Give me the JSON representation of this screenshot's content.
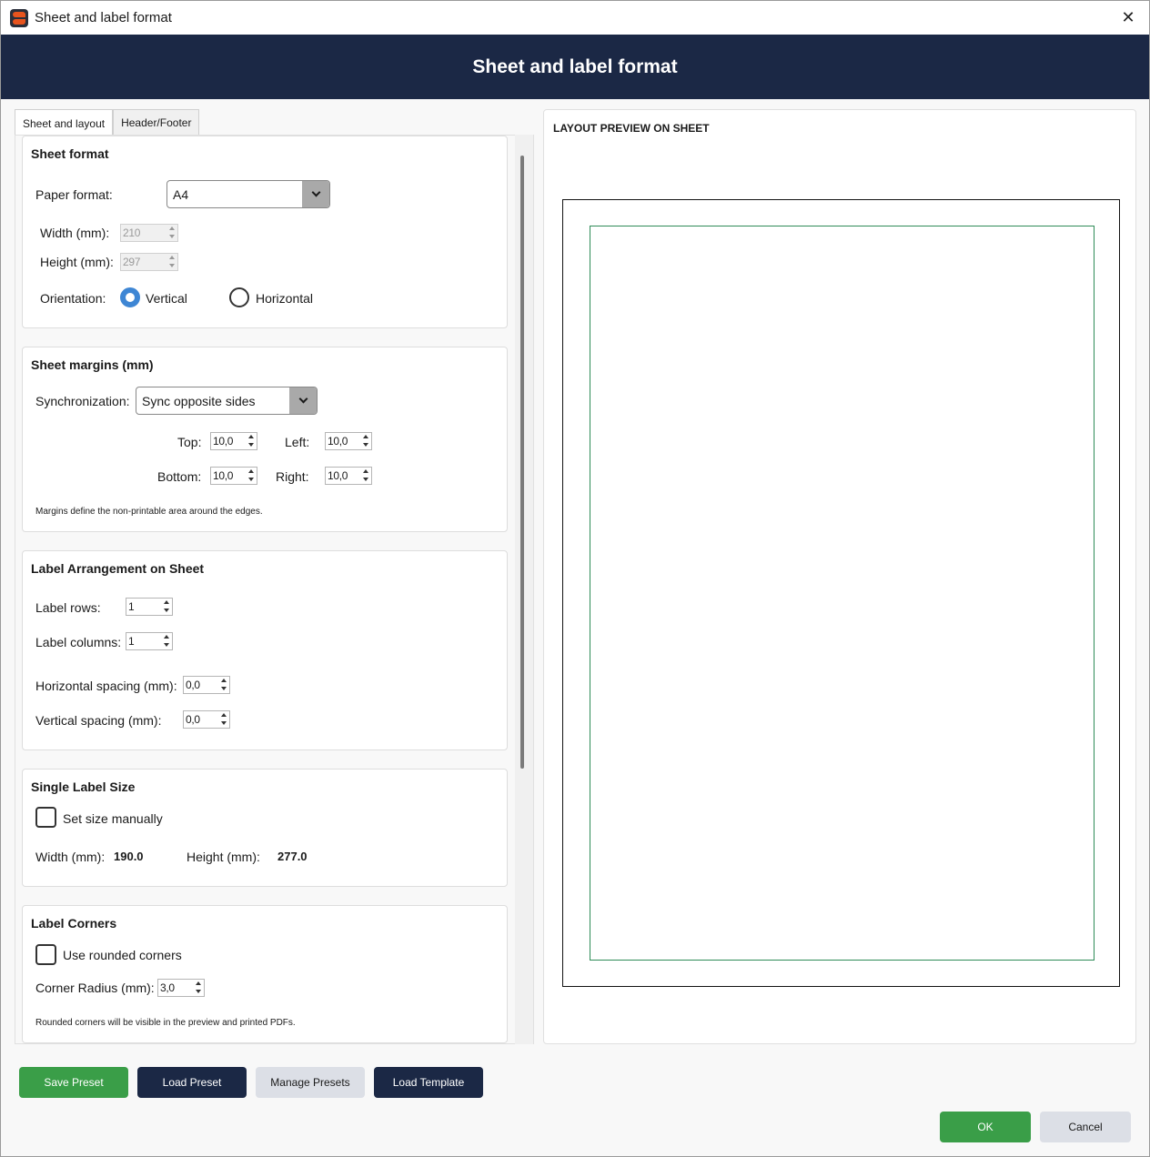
{
  "window": {
    "title": "Sheet and label format",
    "icon": "app-logo-icon"
  },
  "banner": {
    "title": "Sheet and label format"
  },
  "tabs": [
    {
      "label": "Sheet and layout",
      "active": true
    },
    {
      "label": "Header/Footer",
      "active": false
    }
  ],
  "sheet_format": {
    "title": "Sheet format",
    "paper_label": "Paper format:",
    "paper_value": "A4",
    "width_label": "Width (mm):",
    "width_value": "210",
    "height_label": "Height (mm):",
    "height_value": "297",
    "orientation_label": "Orientation:",
    "vertical_label": "Vertical",
    "horizontal_label": "Horizontal",
    "orientation_selected": "Vertical"
  },
  "sheet_margins": {
    "title": "Sheet margins (mm)",
    "sync_label": "Synchronization:",
    "sync_value": "Sync opposite sides",
    "top_label": "Top:",
    "top_value": "10,0",
    "left_label": "Left:",
    "left_value": "10,0",
    "bottom_label": "Bottom:",
    "bottom_value": "10,0",
    "right_label": "Right:",
    "right_value": "10,0",
    "note": "Margins define the non-printable area around the edges."
  },
  "arrangement": {
    "title": "Label Arrangement on Sheet",
    "rows_label": "Label rows:",
    "rows_value": "1",
    "cols_label": "Label columns:",
    "cols_value": "1",
    "hspacing_label": "Horizontal spacing (mm):",
    "hspacing_value": "0,0",
    "vspacing_label": "Vertical spacing (mm):",
    "vspacing_value": "0,0"
  },
  "label_size": {
    "title": "Single Label Size",
    "manual_label": "Set size manually",
    "manual_checked": false,
    "width_label": "Width (mm):",
    "width_value": "190.0",
    "height_label": "Height (mm):",
    "height_value": "277.0"
  },
  "corners": {
    "title": "Label Corners",
    "rounded_label": "Use rounded corners",
    "rounded_checked": false,
    "radius_label": "Corner Radius (mm):",
    "radius_value": "3,0",
    "note": "Rounded corners will be visible in the preview and printed PDFs."
  },
  "preview": {
    "title": "LAYOUT PREVIEW ON SHEET"
  },
  "buttons": {
    "save_preset": "Save Preset",
    "load_preset": "Load Preset",
    "manage_presets": "Manage Presets",
    "load_template": "Load Template",
    "ok": "OK",
    "cancel": "Cancel"
  },
  "colors": {
    "banner": "#1b2845",
    "accent_green": "#3a9e48",
    "radio_selected": "#3e86d4",
    "label_outline": "#2e8b57"
  }
}
